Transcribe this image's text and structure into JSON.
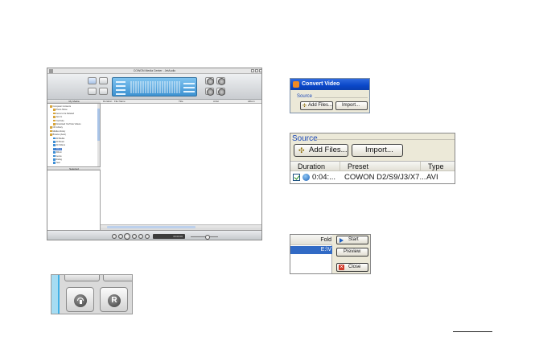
{
  "media_center": {
    "title": "COWON Media Center - JetAudio",
    "left_tab": "My Media",
    "selected_tab": "Selected",
    "columns": [
      "Duration",
      "File Name",
      "Title",
      "Artist",
      "Album"
    ],
    "tree": [
      {
        "label": "Computer Contents",
        "indent": 0
      },
      {
        "label": "Photo Show",
        "indent": 1
      },
      {
        "label": "Items to be Deleted",
        "indent": 1
      },
      {
        "label": "Just In",
        "indent": 1
      },
      {
        "label": "YouTube",
        "indent": 1
      },
      {
        "label": "Download YouTube Videos",
        "indent": 1
      },
      {
        "label": "CD Library",
        "indent": 0
      },
      {
        "label": "Media Library",
        "indent": 0
      },
      {
        "label": "Browse (Auto)",
        "indent": 0
      },
      {
        "label": "All Media",
        "indent": 1
      },
      {
        "label": "All Music",
        "indent": 1
      },
      {
        "label": "All Videos",
        "indent": 1
      },
      {
        "label": "Album",
        "indent": 1
      },
      {
        "label": "Album",
        "indent": 1
      },
      {
        "label": "Genre",
        "indent": 1
      },
      {
        "label": "Rating",
        "indent": 1
      },
      {
        "label": "Year",
        "indent": 1
      }
    ],
    "selected_tree_index": 12,
    "time": "00:00:00"
  },
  "convert_dialog": {
    "title": "Convert Video",
    "group_label": "Source",
    "add_files": "Add Files...",
    "import": "Import..."
  },
  "source_zoom": {
    "group_label": "Source",
    "add_files": "Add Files...",
    "import": "Import...",
    "columns": [
      "Duration",
      "Preset",
      "Type"
    ],
    "row": {
      "duration": "0:04:...",
      "preset": "COWON D2/S9/J3/X7...",
      "type": "AVI"
    }
  },
  "action_panel": {
    "folder_header": "Fold",
    "selected_row": "E:\\V",
    "start": "Start",
    "preview": "Preview",
    "close": "Close"
  },
  "zoom_buttons": {
    "second_button_glyph": "R"
  }
}
